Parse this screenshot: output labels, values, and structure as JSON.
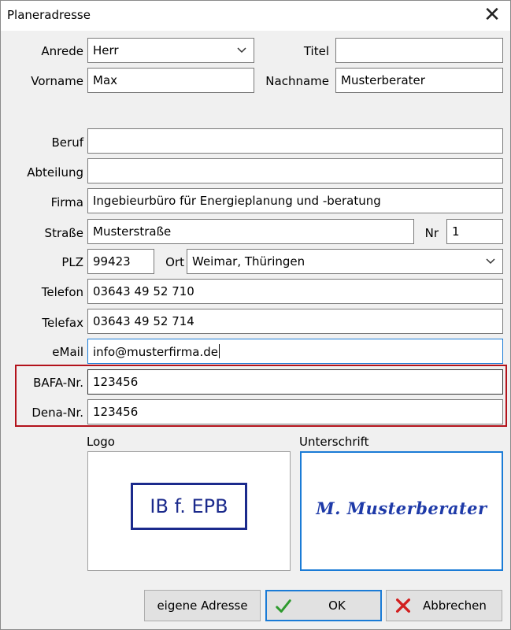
{
  "window": {
    "title": "Planeradresse",
    "close_glyph": "✕"
  },
  "form": {
    "anrede": {
      "label": "Anrede",
      "value": "Herr"
    },
    "titel": {
      "label": "Titel",
      "value": ""
    },
    "vorname": {
      "label": "Vorname",
      "value": "Max"
    },
    "nachname": {
      "label": "Nachname",
      "value": "Musterberater"
    },
    "beruf": {
      "label": "Beruf",
      "value": ""
    },
    "abteilung": {
      "label": "Abteilung",
      "value": ""
    },
    "firma": {
      "label": "Firma",
      "value": "Ingebieurbüro für Energieplanung und -beratung"
    },
    "strasse": {
      "label": "Straße",
      "value": "Musterstraße"
    },
    "nr": {
      "label": "Nr",
      "value": "1"
    },
    "plz": {
      "label": "PLZ",
      "value": "99423"
    },
    "ort": {
      "label": "Ort",
      "value": "Weimar, Thüringen"
    },
    "telefon": {
      "label": "Telefon",
      "value": "03643 49 52 710"
    },
    "telefax": {
      "label": "Telefax",
      "value": "03643 49 52 714"
    },
    "email": {
      "label": "eMail",
      "value": "info@musterfirma.de"
    },
    "bafa": {
      "label": "BAFA-Nr.",
      "value": "123456"
    },
    "dena": {
      "label": "Dena-Nr.",
      "value": "123456"
    }
  },
  "images": {
    "logo_label": "Logo",
    "logo_text": "IB f. EPB",
    "signature_label": "Unterschrift",
    "signature_text": "M. Musterberater"
  },
  "buttons": {
    "own_address": "eigene Adresse",
    "ok": "OK",
    "cancel": "Abbrechen"
  },
  "colors": {
    "accent": "#1a7bd6",
    "highlight": "#b3121b",
    "logo_navy": "#1b2a8c",
    "signature_blue": "#1e3aa8",
    "ok_check": "#2e9a2e",
    "cancel_x": "#d21f1f"
  },
  "icons": {
    "close": "close-icon",
    "combo": "chevron-down-icon",
    "ok": "checkmark-icon",
    "cancel": "red-x-icon"
  }
}
